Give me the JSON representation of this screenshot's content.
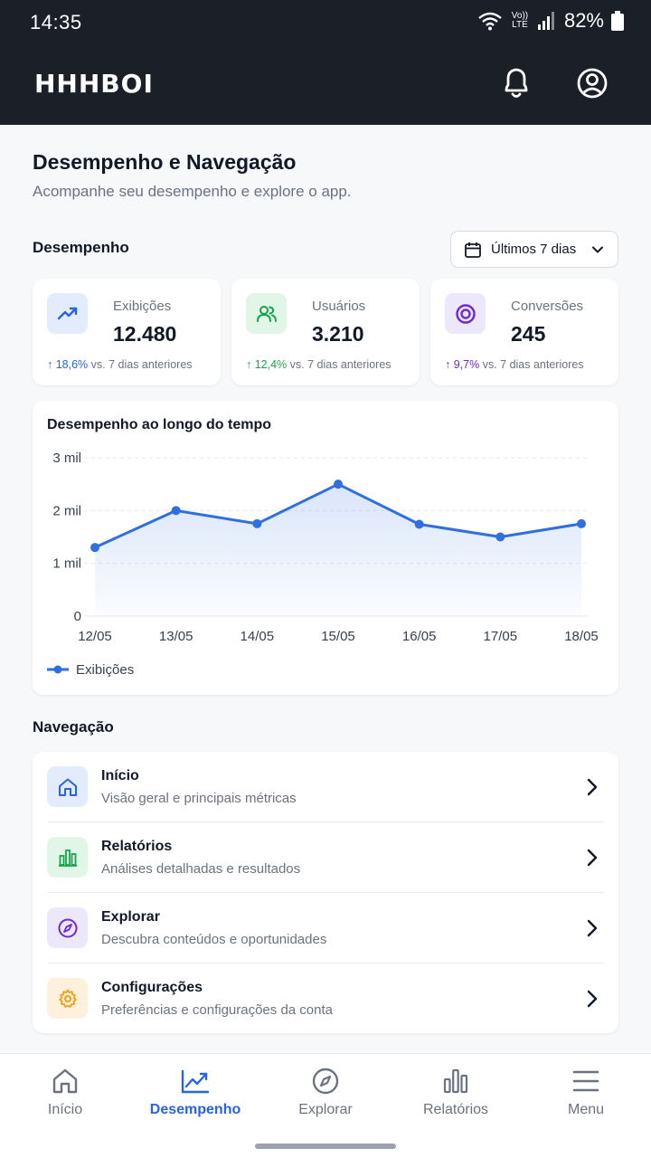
{
  "status": {
    "time": "14:35",
    "network": "Vo)) LTE",
    "battery": "82%"
  },
  "app": {
    "brand": "HHHBOI"
  },
  "page": {
    "title": "Desempenho e Navegação",
    "subtitle": "Acompanhe seu desempenho e explore o app."
  },
  "performance": {
    "section_title": "Desempenho",
    "range_label": "Últimos 7 dias",
    "stats": [
      {
        "label": "Exibições",
        "value": "12.480",
        "delta": "↑ 18,6%",
        "delta_note": "vs. 7 dias anteriores",
        "icon": "trend-up-icon",
        "color": "#2563eb",
        "bg": "#e3ecfd"
      },
      {
        "label": "Usuários",
        "value": "3.210",
        "delta": "↑ 12,4%",
        "delta_note": "vs. 7 dias anteriores",
        "icon": "users-icon",
        "color": "#16a34a",
        "bg": "#e2f6e8"
      },
      {
        "label": "Conversões",
        "value": "245",
        "delta": "↑ 9,7%",
        "delta_note": "vs. 7 dias anteriores",
        "icon": "target-icon",
        "color": "#6d28d9",
        "bg": "#ede7fb"
      }
    ]
  },
  "chart_data": {
    "type": "area",
    "title": "Desempenho ao longo do tempo",
    "categories": [
      "12/05",
      "13/05",
      "14/05",
      "15/05",
      "16/05",
      "17/05",
      "18/05"
    ],
    "series": [
      {
        "name": "Exibições",
        "values": [
          1300,
          2000,
          1750,
          2500,
          1740,
          1500,
          1750
        ],
        "color": "#2f6fe0"
      }
    ],
    "yticks": [
      "0",
      "1 mil",
      "2 mil",
      "3 mil"
    ],
    "ylim": [
      0,
      3000
    ],
    "grid": true,
    "legend": "bottom-left"
  },
  "navigation": {
    "section_title": "Navegação",
    "items": [
      {
        "title": "Início",
        "subtitle": "Visão geral e principais métricas",
        "icon": "home-icon",
        "color": "#2563eb",
        "bg": "#e3ecfd"
      },
      {
        "title": "Relatórios",
        "subtitle": "Análises detalhadas e resultados",
        "icon": "bar-chart-icon",
        "color": "#16a34a",
        "bg": "#e2f6e8"
      },
      {
        "title": "Explorar",
        "subtitle": "Descubra conteúdos e oportunidades",
        "icon": "compass-icon",
        "color": "#6d28d9",
        "bg": "#ede7fb"
      },
      {
        "title": "Configurações",
        "subtitle": "Preferências e configurações da conta",
        "icon": "gear-icon",
        "color": "#f59e0b",
        "bg": "#fdf0dc"
      }
    ]
  },
  "bottom_nav": {
    "tabs": [
      {
        "label": "Início",
        "icon": "home-icon",
        "active": false
      },
      {
        "label": "Desempenho",
        "icon": "trend-up-icon",
        "active": true
      },
      {
        "label": "Explorar",
        "icon": "compass-icon",
        "active": false
      },
      {
        "label": "Relatórios",
        "icon": "bar-chart-icon",
        "active": false
      },
      {
        "label": "Menu",
        "icon": "menu-icon",
        "active": false
      }
    ]
  }
}
